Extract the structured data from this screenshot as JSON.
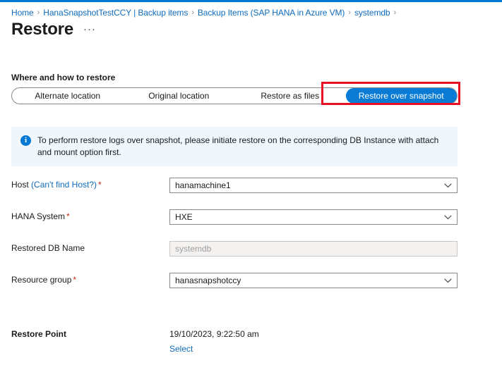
{
  "theme": {
    "accent": "#0078d4",
    "link": "#0f6cbd",
    "selected_pill": "#0a7bd4",
    "highlight_box": "#e81123",
    "info_banner_bg": "#eff6fc",
    "required_star": "#c42b1c",
    "disabled_bg": "#f3f2f1"
  },
  "breadcrumb": {
    "items": [
      {
        "label": "Home"
      },
      {
        "label": "HanaSnapshotTestCCY | Backup items"
      },
      {
        "label": "Backup Items (SAP HANA in Azure VM)"
      },
      {
        "label": "systemdb"
      }
    ],
    "separator": "›"
  },
  "header": {
    "title": "Restore",
    "more_actions": "···"
  },
  "section": {
    "heading": "Where and how to restore"
  },
  "pivot": {
    "items": [
      {
        "label": "Alternate location",
        "selected": false
      },
      {
        "label": "Original location",
        "selected": false
      },
      {
        "label": "Restore as files",
        "selected": false
      },
      {
        "label": "Restore over snapshot",
        "selected": true
      }
    ]
  },
  "info_banner": {
    "icon": "info-icon",
    "icon_glyph": "i",
    "text": "To perform restore logs over snapshot, please initiate restore on the corresponding DB Instance with attach and mount option first."
  },
  "form": {
    "fields": [
      {
        "label": "Host",
        "sub_link": "(Can't find Host?)",
        "required": true,
        "value": "hanamachine1",
        "placeholder": "",
        "type": "dropdown",
        "disabled": false
      },
      {
        "label": "HANA System",
        "sub_link": "",
        "required": true,
        "value": "HXE",
        "placeholder": "",
        "type": "dropdown",
        "disabled": false
      },
      {
        "label": "Restored DB Name",
        "sub_link": "",
        "required": false,
        "value": "",
        "placeholder": "systemdb",
        "type": "text",
        "disabled": true
      },
      {
        "label": "Resource group",
        "sub_link": "",
        "required": true,
        "value": "hanasnapshotccy",
        "placeholder": "",
        "type": "dropdown",
        "disabled": false
      }
    ],
    "required_marker": "*"
  },
  "restore_point": {
    "label": "Restore Point",
    "value": "19/10/2023, 9:22:50 am",
    "select_link": "Select"
  }
}
